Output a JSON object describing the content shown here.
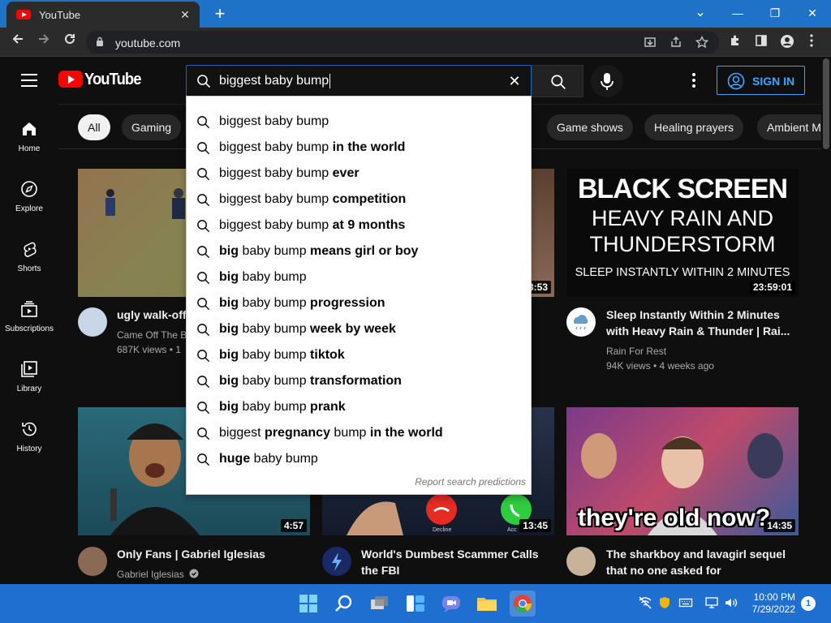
{
  "browser": {
    "tab_title": "YouTube",
    "tab_close": "✕",
    "new_tab": "+",
    "url": "youtube.com",
    "window_controls": {
      "minimize": "—",
      "restore": "❐",
      "close": "✕",
      "dropdown": "⌄"
    }
  },
  "header": {
    "logo_text": "YouTube",
    "search_query": "biggest baby bump",
    "sign_in": "SIGN IN"
  },
  "chips": [
    "All",
    "Gaming",
    "Game shows",
    "Healing prayers",
    "Ambient M"
  ],
  "rail": [
    {
      "label": "Home",
      "icon": "home-icon"
    },
    {
      "label": "Explore",
      "icon": "compass-icon"
    },
    {
      "label": "Shorts",
      "icon": "shorts-icon"
    },
    {
      "label": "Subscriptions",
      "icon": "subscriptions-icon"
    },
    {
      "label": "Library",
      "icon": "library-icon"
    },
    {
      "label": "History",
      "icon": "history-icon"
    }
  ],
  "suggestions": [
    {
      "typed": "biggest baby bump",
      "rest": ""
    },
    {
      "typed": "biggest baby bump",
      "rest": " in the world"
    },
    {
      "typed": "biggest baby bump",
      "rest": " ever"
    },
    {
      "typed": "biggest baby bump",
      "rest": " competition"
    },
    {
      "typed": "biggest baby bump",
      "rest": " at 9 months"
    },
    {
      "bold1": "big",
      "normal": " baby bump",
      "bold2": " means girl or boy"
    },
    {
      "bold1": "big",
      "normal": " baby bump",
      "bold2": ""
    },
    {
      "bold1": "big",
      "normal": " baby bump",
      "bold2": " progression"
    },
    {
      "bold1": "big",
      "normal": " baby bump",
      "bold2": " week by week"
    },
    {
      "bold1": "big",
      "normal": " baby bump",
      "bold2": " tiktok"
    },
    {
      "bold1": "big",
      "normal": " baby bump",
      "bold2": " transformation"
    },
    {
      "bold1": "big",
      "normal": " baby bump",
      "bold2": " prank"
    },
    {
      "pre": "biggest ",
      "bold1": "pregnancy",
      "normal": " bump",
      "bold2": " in the world"
    },
    {
      "bold1": "huge",
      "normal": " baby bump",
      "bold2": ""
    }
  ],
  "report_label": "Report search predictions",
  "videos": [
    {
      "title": "ugly walk-offs",
      "channel": "Came Off The B",
      "meta": "687K views • 1"
    },
    {
      "duration": "",
      "duration_partial": "3:53"
    },
    {
      "title": "Sleep Instantly Within 2 Minutes with Heavy Rain & Thunder | Rai...",
      "channel": "Rain For Rest",
      "meta": "94K views • 4 weeks ago",
      "duration": "23:59:01",
      "thumb_lines": [
        "BLACK SCREEN",
        "HEAVY RAIN AND",
        "THUNDERSTORM",
        "SLEEP INSTANTLY WITHIN 2 MINUTES"
      ]
    },
    {
      "title": "Only Fans | Gabriel Iglesias",
      "channel": "Gabriel Iglesias",
      "duration": "4:57"
    },
    {
      "title": "World's Dumbest Scammer Calls the FBI",
      "duration": "13:45",
      "thumb_labels": [
        "Decline",
        "Acc"
      ]
    },
    {
      "title": "The sharkboy and lavagirl sequel that no one asked for",
      "duration": "14:35",
      "thumb_caption": "they're old now?"
    }
  ],
  "taskbar": {
    "time": "10:00 PM",
    "date": "7/29/2022",
    "notifications": "1"
  }
}
